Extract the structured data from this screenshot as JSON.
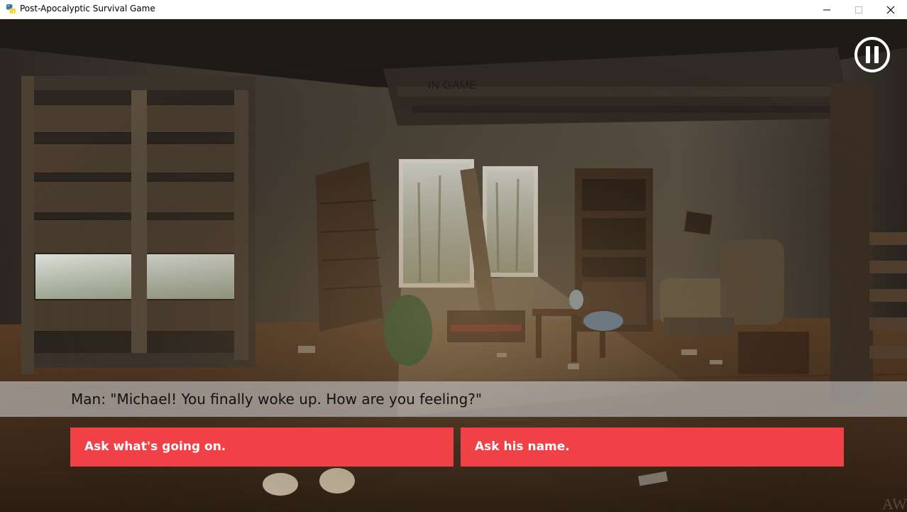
{
  "window": {
    "title": "Post-Apocalyptic Survival Game",
    "app_icon": "python-icon",
    "controls": [
      "minimize-icon",
      "maximize-icon",
      "close-icon"
    ]
  },
  "game": {
    "scene": "abandoned ruined room interior",
    "state_label": "IN GAME",
    "pause_icon": "pause-icon",
    "dialogue": {
      "text": "Man: \"Michael! You finally woke up. How are you feeling?\""
    },
    "choices": [
      {
        "label": "Ask what's going on."
      },
      {
        "label": "Ask his name."
      }
    ],
    "corner_mark": "AW"
  },
  "colors": {
    "choice_button": "#ef4146",
    "dialogue_bar": "rgba(200,200,200,0.62)",
    "pause_ring": "#ffffff"
  }
}
